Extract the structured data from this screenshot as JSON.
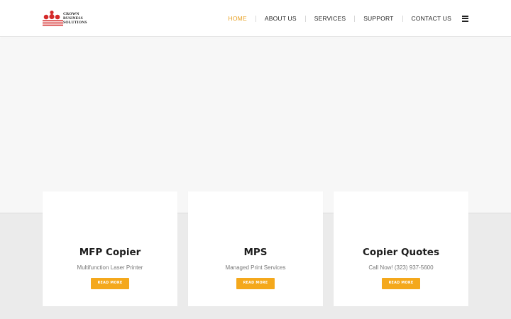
{
  "logo": {
    "line1": "CROWN",
    "line2": "BUSINESS",
    "line3": "SOLUTIONS",
    "dot_color": "#d42a2a"
  },
  "nav": {
    "items": [
      {
        "label": "HOME",
        "active": true
      },
      {
        "label": "ABOUT US",
        "active": false
      },
      {
        "label": "SERVICES",
        "active": false
      },
      {
        "label": "SUPPORT",
        "active": false
      },
      {
        "label": "CONTACT US",
        "active": false
      }
    ],
    "menu_icon": "hamburger-icon",
    "active_color": "#e8a020"
  },
  "cards": [
    {
      "title": "MFP Copier",
      "subtitle": "Multifunction Laser Printer",
      "button": "READ MORE"
    },
    {
      "title": "MPS",
      "subtitle": "Managed Print Services",
      "button": "READ MORE"
    },
    {
      "title": "Copier Quotes",
      "subtitle": "Call Now! (323) 937-5600",
      "button": "READ MORE"
    }
  ],
  "colors": {
    "button": "#f4a81c",
    "hero_bg": "#f7f7f7",
    "lower_bg": "#ebebeb"
  }
}
